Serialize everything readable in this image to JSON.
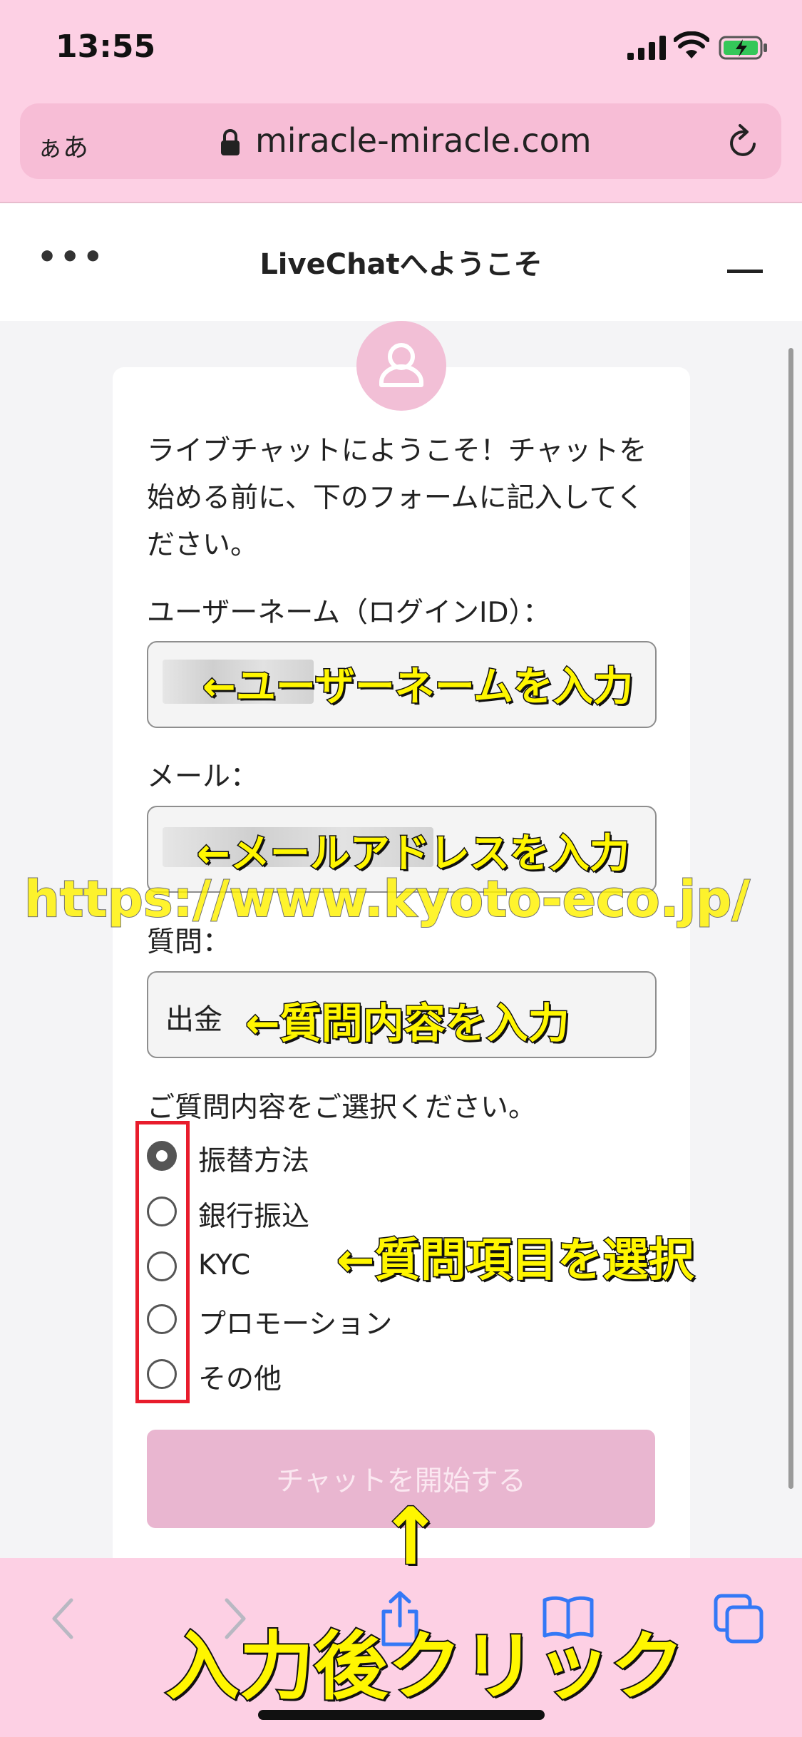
{
  "status_bar": {
    "time": "13:55"
  },
  "browser": {
    "text_size_label": "ぁあ",
    "url": "miracle-miracle.com"
  },
  "chat_header": {
    "more_label": "•••",
    "title": "LiveChatへようこそ"
  },
  "form": {
    "intro": "ライブチャットにようこそ！チャットを始める前に、下のフォームに記入してください。",
    "username_label": "ユーザーネーム（ログインID）：",
    "email_label": "メール：",
    "question_label": "質問：",
    "question_value": "出金",
    "select_label": "ご質問内容をご選択ください。",
    "options": [
      "振替方法",
      "銀行振込",
      "KYC",
      "プロモーション",
      "その他"
    ],
    "selected_index": 0,
    "start_button": "チャットを開始する"
  },
  "annotations": {
    "username_hint": "←ユーザーネームを入力",
    "email_hint": "←メールアドレスを入力",
    "question_hint": "←質問内容を入力",
    "option_hint": "←質問項目を選択",
    "click_hint": "入力後クリック",
    "arrow": "↑",
    "watermark": "https://www.kyoto-eco.jp/"
  },
  "colors": {
    "browser_pink": "#fdd0e4",
    "url_pill": "#f7bdd6",
    "button_pink": "#e9b6d0",
    "annotation_yellow": "#fff600",
    "highlight_red": "#e81c2c",
    "ios_blue": "#3478f6"
  }
}
